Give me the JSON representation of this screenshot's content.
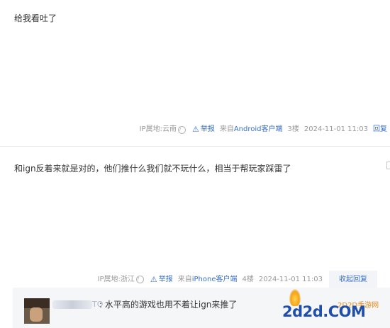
{
  "posts": [
    {
      "content": "给我看吐了",
      "ip_location": "IP属地:云南",
      "report_label": "举报",
      "via_prefix": "来自",
      "device": "Android客户端",
      "floor": "3楼",
      "time": "2024-11-01 11:03",
      "action": "回复"
    },
    {
      "content": "和ign反着来就是对的，他们推什么我们就不玩什么，相当于帮玩家踩雷了",
      "ip_location": "IP属地:浙江",
      "report_label": "举报",
      "via_prefix": "来自",
      "device": "iPhone客户端",
      "floor": "4楼",
      "time": "2024-11-01 11:03",
      "action": "收起回复"
    }
  ],
  "sub_reply": {
    "name_tail": "TO",
    "text": ": 水平高的游戏也用不着让ign来推了"
  },
  "watermark": {
    "brand": "2d2d.COM",
    "tagline": "2D2D手游网"
  },
  "icons": {
    "help": "question-circle-icon",
    "report": "warning-triangle-icon"
  },
  "colors": {
    "link": "#3a6fc4",
    "meta_text": "#999999",
    "subreply_bg": "#f5f6f8"
  }
}
